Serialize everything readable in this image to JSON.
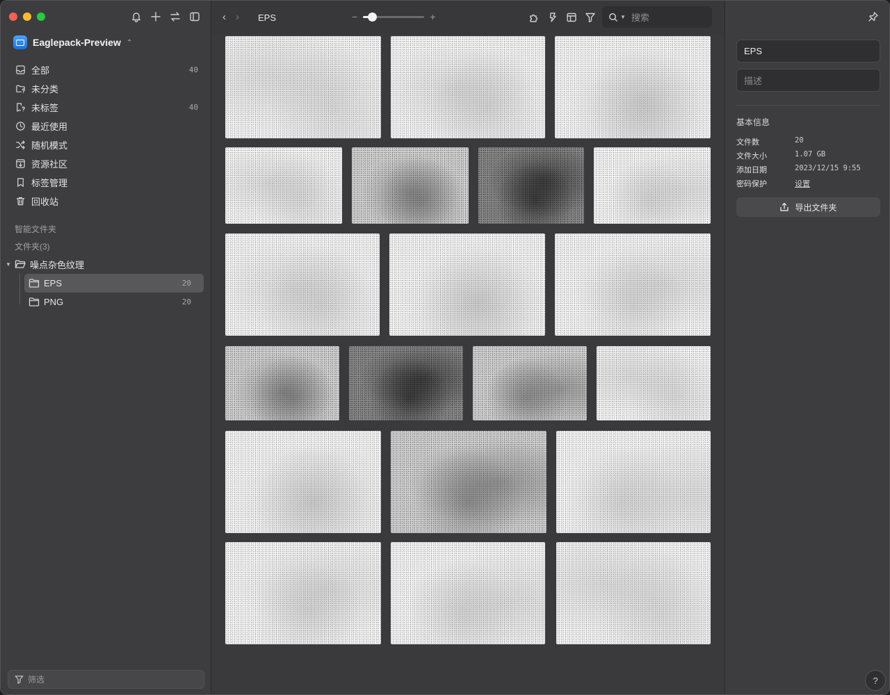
{
  "window": {
    "traffic_colors": [
      "#ff5f57",
      "#febc2e",
      "#28c840"
    ]
  },
  "sidebar": {
    "library_name": "Eaglepack-Preview",
    "items": [
      {
        "label": "全部",
        "count": "40",
        "icon": "inbox-icon"
      },
      {
        "label": "未分类",
        "count": "",
        "icon": "folder-question-icon"
      },
      {
        "label": "未标签",
        "count": "40",
        "icon": "tag-question-icon"
      },
      {
        "label": "最近使用",
        "count": "",
        "icon": "clock-icon"
      },
      {
        "label": "随机模式",
        "count": "",
        "icon": "shuffle-icon"
      },
      {
        "label": "资源社区",
        "count": "",
        "icon": "download-box-icon"
      },
      {
        "label": "标签管理",
        "count": "",
        "icon": "bookmark-icon"
      },
      {
        "label": "回收站",
        "count": "",
        "icon": "trash-icon"
      }
    ],
    "smart_folders_label": "智能文件夹",
    "folders_label": "文件夹(3)",
    "folder_tree": {
      "parent": {
        "label": "噪点杂色纹理"
      },
      "children": [
        {
          "label": "EPS",
          "count": "20"
        },
        {
          "label": "PNG",
          "count": "20"
        }
      ]
    },
    "filter_placeholder": "筛选"
  },
  "toolbar": {
    "title": "EPS",
    "zoom_minus": "−",
    "zoom_plus": "+",
    "zoom_level": 0.15,
    "search_placeholder": "搜索"
  },
  "grid": {
    "rows": [
      [
        {
          "tone": "light"
        },
        {
          "tone": "light"
        },
        {
          "tone": "light"
        }
      ],
      [
        {
          "tone": "light"
        },
        {
          "tone": "mid"
        },
        {
          "tone": "dark"
        },
        {
          "tone": "light"
        }
      ],
      [
        {
          "tone": "light"
        },
        {
          "tone": "light"
        },
        {
          "tone": "light"
        }
      ],
      [
        {
          "tone": "mid"
        },
        {
          "tone": "dark"
        },
        {
          "tone": "mid"
        },
        {
          "tone": "light"
        }
      ],
      [
        {
          "tone": "light"
        },
        {
          "tone": "mid"
        },
        {
          "tone": "light"
        }
      ],
      [
        {
          "tone": "light"
        },
        {
          "tone": "light"
        },
        {
          "tone": "light"
        }
      ]
    ]
  },
  "inspector": {
    "name_value": "EPS",
    "description_placeholder": "描述",
    "info_title": "基本信息",
    "info": [
      {
        "key": "文件数",
        "value": "20"
      },
      {
        "key": "文件大小",
        "value": "1.07 GB"
      },
      {
        "key": "添加日期",
        "value": "2023/12/15 9:55"
      },
      {
        "key": "密码保护",
        "value": "设置"
      }
    ],
    "export_label": "导出文件夹",
    "help_label": "?"
  }
}
